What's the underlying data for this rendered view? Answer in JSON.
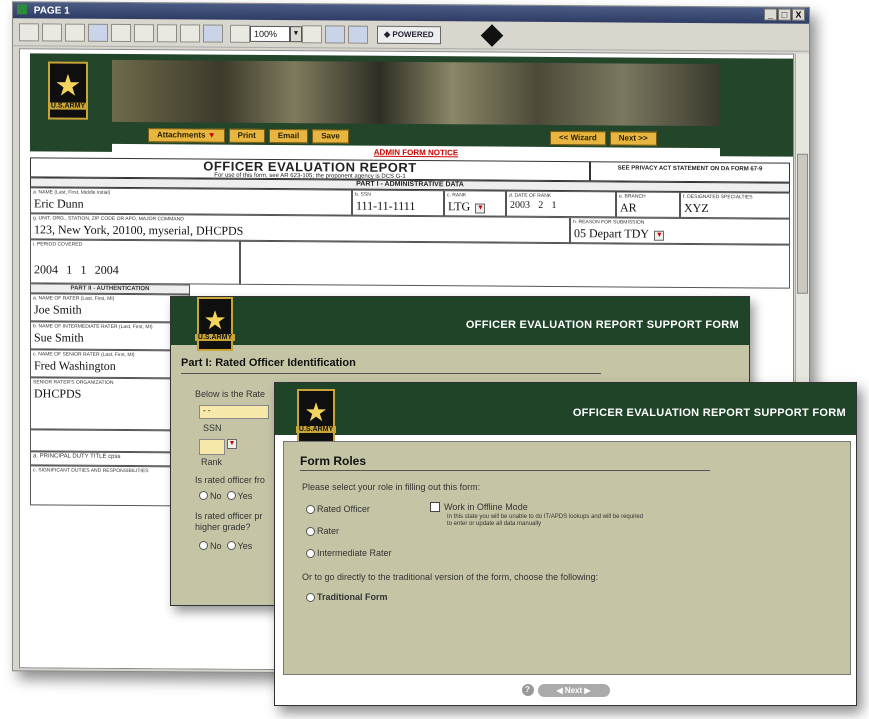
{
  "window": {
    "title": "PAGE 1",
    "controls": [
      "_",
      "□",
      "X"
    ]
  },
  "toolbar": {
    "zoom": "100%",
    "powered": "POWERED"
  },
  "banner": {
    "logo_text": "U.S.ARMY",
    "buttons_left": [
      "Attachments",
      "Print",
      "Email",
      "Save"
    ],
    "buttons_right": [
      "<< Wizard",
      "Next >>"
    ],
    "notice": "ADMIN FORM NOTICE"
  },
  "oer": {
    "title": "OFFICER EVALUATION REPORT",
    "subtitle": "For use of this form, see AR 623-105; the proponent agency is DCS G-1",
    "privacy": "SEE PRIVACY ACT STATEMENT ON DA FORM 67-9",
    "part1": "PART I - ADMINISTRATIVE DATA",
    "name_label": "a. NAME (Last, First, Middle Initial)",
    "name": "Eric Dunn",
    "ssn_label": "b. SSN",
    "ssn": "111-11-1111",
    "rank_label": "c. RANK",
    "rank": "LTG",
    "date_label": "d. DATE OF RANK",
    "date_year": "2003",
    "date_month": "2",
    "date_day": "1",
    "branch_label": "e. BRANCH",
    "branch": "AR",
    "designated_label": "f. DESIGNATED SPECIALTIES",
    "designated": "XYZ",
    "unit_label": "g. UNIT, ORG., STATION, ZIP CODE OR APO, MAJOR COMMAND",
    "unit": "123, New York, 20100, myserial, DHCPDS",
    "reason_label": "h. REASON FOR SUBMISSION",
    "reason": "05 Depart TDY",
    "period_label": "i. PERIOD COVERED",
    "from_year": "2004",
    "from_month": "1",
    "from_day": "1",
    "thru_year": "2004",
    "part2": "PART II - AUTHENTICATION",
    "rater_label": "a. NAME OF RATER (Last, First, MI)",
    "rater": "Joe Smith",
    "intermediate_label": "b. NAME OF INTERMEDIATE RATER (Last, First, MI)",
    "intermediate": "Sue Smith",
    "senior_label": "c. NAME OF SENIOR RATER (Last, First, MI)",
    "senior": "Fred Washington",
    "org_label": "SENIOR RATER'S ORGANIZATION",
    "org": "DHCPDS",
    "duty_title": "a. PRINCIPAL DUTY TITLE  cpss",
    "significant_duties": "c. SIGNIFICANT DUTIES AND RESPONSIBILITIES"
  },
  "mid_form": {
    "logo_text": "U.S.ARMY",
    "title": "OFFICER EVALUATION REPORT SUPPORT FORM",
    "section": "Part I: Rated Officer Identification",
    "below_text": "Below is the Rate",
    "field1_value": "- -",
    "ssn_label": "SSN",
    "rank_label": "Rank",
    "q1": "Is rated officer fro",
    "q2": "Is rated officer pr",
    "q2b": "higher grade?",
    "no": "No",
    "yes": "Yes"
  },
  "front_form": {
    "logo_text": "U.S.ARMY",
    "title": "OFFICER EVALUATION REPORT SUPPORT FORM",
    "section": "Form Roles",
    "instruction": "Please select your role in filling out this form:",
    "role_rated": "Rated Officer",
    "role_rater": "Rater",
    "role_intermediate": "Intermediate Rater",
    "offline_label": "Work in Offline Mode",
    "offline_note": "In this state you will be unable to do IT/APDS lookups and will be required to enter or update all data manually",
    "traditional_text": "Or to go directly to the traditional version of the form, choose the following:",
    "traditional": "Traditional Form",
    "help": "?",
    "next": "Next"
  }
}
